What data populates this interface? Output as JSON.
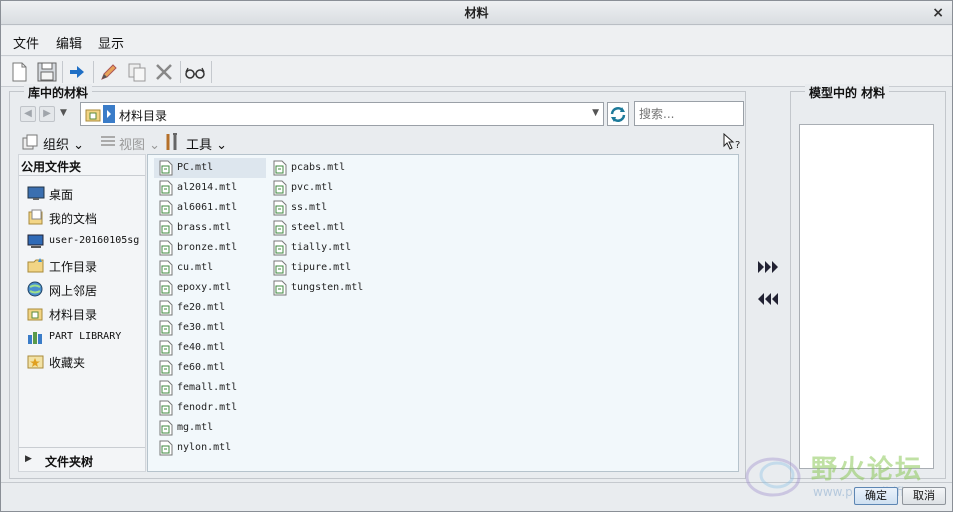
{
  "window": {
    "title": "材料",
    "close_glyph": "×"
  },
  "menu": {
    "items": [
      "文件",
      "编辑",
      "显示"
    ]
  },
  "toolbar": {
    "icons": [
      "new-file-icon",
      "save-icon",
      "arrow-right-icon",
      "pencil-icon",
      "copy-icon",
      "delete-icon",
      "glasses-icon"
    ]
  },
  "library": {
    "group_title": "库中的材料",
    "path": "材料目录",
    "search_placeholder": "搜索...",
    "organize_label": "组织",
    "view_label": "视图",
    "tools_label": "工具"
  },
  "common_folders": {
    "title": "公用文件夹",
    "items": [
      {
        "label": "桌面",
        "icon": "desktop-icon"
      },
      {
        "label": "我的文档",
        "icon": "documents-icon"
      },
      {
        "label": "user-20160105sg",
        "icon": "computer-icon"
      },
      {
        "label": "工作目录",
        "icon": "working-folder-icon"
      },
      {
        "label": "网上邻居",
        "icon": "network-icon"
      },
      {
        "label": "材料目录",
        "icon": "material-folder-icon"
      },
      {
        "label": "PART LIBRARY",
        "icon": "part-library-icon"
      },
      {
        "label": "收藏夹",
        "icon": "favorites-icon"
      }
    ],
    "folder_tree_label": "文件夹树"
  },
  "files": {
    "column1": [
      "PC.mtl",
      "al2014.mtl",
      "al6061.mtl",
      "brass.mtl",
      "bronze.mtl",
      "cu.mtl",
      "epoxy.mtl",
      "fe20.mtl",
      "fe30.mtl",
      "fe40.mtl",
      "fe60.mtl",
      "femall.mtl",
      "fenodr.mtl",
      "mg.mtl",
      "nylon.mtl"
    ],
    "column2": [
      "pcabs.mtl",
      "pvc.mtl",
      "ss.mtl",
      "steel.mtl",
      "tially.mtl",
      "tipure.mtl",
      "tungsten.mtl"
    ],
    "selected": "PC.mtl"
  },
  "model": {
    "group_title": "模型中的 材料"
  },
  "buttons": {
    "ok": "确定",
    "cancel": "取消"
  },
  "watermark": {
    "text": "野火论坛",
    "url": "www.proewildfire.cn"
  }
}
